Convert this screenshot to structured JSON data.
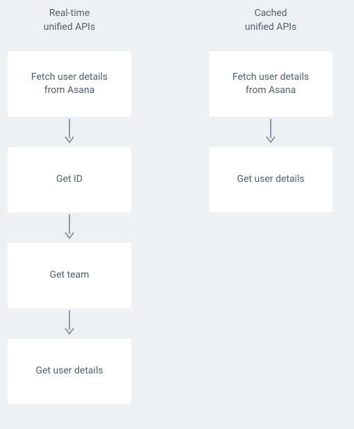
{
  "columns": [
    {
      "title": "Real-time\nunified APIs",
      "steps": [
        "Fetch user details\nfrom Asana",
        "Get ID",
        "Get team",
        "Get user details"
      ]
    },
    {
      "title": "Cached\nunified APIs",
      "steps": [
        "Fetch user details\nfrom Asana",
        "Get user details"
      ]
    }
  ],
  "colors": {
    "bg": "#eef1f4",
    "node_bg": "#ffffff",
    "text": "#4f5f6d",
    "arrow": "#8a98a5"
  }
}
